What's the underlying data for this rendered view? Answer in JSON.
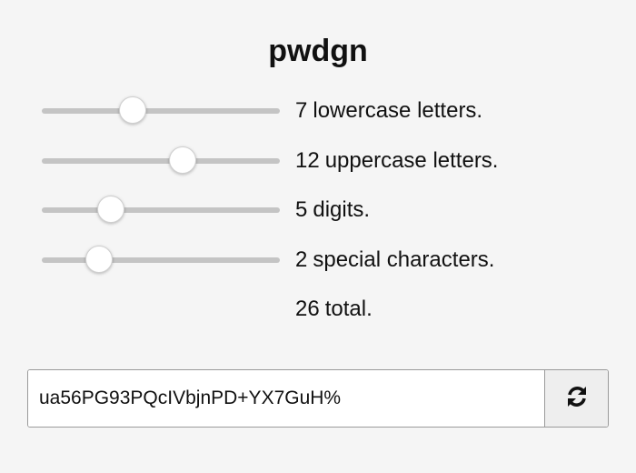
{
  "app": {
    "title": "pwdgn"
  },
  "sliders": [
    {
      "value": 7,
      "label": "lowercase letters.",
      "level": 0.38
    },
    {
      "value": 12,
      "label": "uppercase letters.",
      "level": 0.59
    },
    {
      "value": 5,
      "label": "digits.",
      "level": 0.29
    },
    {
      "value": 2,
      "label": "special characters.",
      "level": 0.24
    }
  ],
  "total": {
    "value": 26,
    "label": "total."
  },
  "password": {
    "value": "ua56PG93PQcIVbjnPD+YX7GuH%"
  },
  "refresh": {
    "icon": "refresh-icon"
  }
}
